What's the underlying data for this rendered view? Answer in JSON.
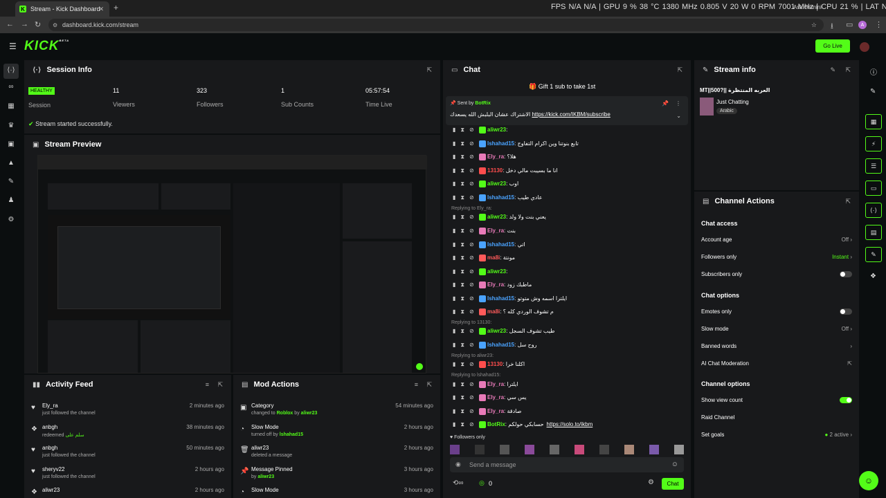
{
  "browser": {
    "tab_title": "Stream - Kick Dashboard",
    "url": "dashboard.kick.com/stream",
    "ask_gemini": "Ask Gemini",
    "perf": "FPS N/A N/A | GPU 9 % 38 °C 1380 MHz 0.805 V 20 W 0 RPM 7001 MHz | CPU 21 % | LAT N/A N/A"
  },
  "topbar": {
    "logo": "KICK",
    "beta": "BETA",
    "go_live": "Go Live"
  },
  "session": {
    "title": "Session Info",
    "status_badge": "HEALTHY",
    "session_label": "Session",
    "stats": [
      {
        "value": "11",
        "label": "Viewers"
      },
      {
        "value": "323",
        "label": "Followers"
      },
      {
        "value": "1",
        "label": "Sub Counts"
      },
      {
        "value": "05:57:54",
        "label": "Time Live"
      }
    ],
    "notice": "Stream started successfully."
  },
  "preview": {
    "title": "Stream Preview"
  },
  "activity": {
    "title": "Activity Feed",
    "items": [
      {
        "name": "Ely_ra",
        "sub": "just followed the channel",
        "time": "2 minutes ago"
      },
      {
        "name": "anbgh",
        "sub": "redeemed",
        "sub2": "سلم على",
        "time": "38 minutes ago"
      },
      {
        "name": "anbgh",
        "sub": "just followed the channel",
        "time": "50 minutes ago"
      },
      {
        "name": "sheryv22",
        "sub": "just followed the channel",
        "time": "2 hours ago"
      },
      {
        "name": "aliwr23",
        "sub": "",
        "time": "2 hours ago"
      }
    ]
  },
  "mod": {
    "title": "Mod Actions",
    "items": [
      {
        "name": "Category",
        "sub": "changed to",
        "hl": "Roblox",
        "by": "by",
        "user": "aliwr23",
        "time": "54 minutes ago"
      },
      {
        "name": "Slow Mode",
        "sub": "turned off by",
        "user": "lshahad15",
        "time": "2 hours ago"
      },
      {
        "name": "aliwr23",
        "sub": "deleted a message",
        "time": "2 hours ago"
      },
      {
        "name": "Message Pinned",
        "sub": "by",
        "user": "aliwr23",
        "time": "3 hours ago"
      },
      {
        "name": "Slow Mode",
        "sub": "",
        "time": "3 hours ago"
      }
    ]
  },
  "chat": {
    "title": "Chat",
    "gift": "Gift 1 sub to take 1st",
    "pinned_sent_by": "Sent by",
    "pinned_user": "BotRix",
    "pinned_text": "الاشتراك عشان البلبش الله يسعدك",
    "pinned_link": "https://kick.com/IKBM/subscribe",
    "lines": [
      {
        "user": "aliwr23",
        "color": "#53fc18",
        "text": ""
      },
      {
        "user": "lshahad15",
        "color": "#4aa3ff",
        "text": "تابع بنوتنا وين اكرام التفاوج"
      },
      {
        "user": "Ely_ra",
        "color": "#e87ab8",
        "text": "هلا؟"
      },
      {
        "user": "13130",
        "color": "#ff4d4d",
        "text": "انا ما بسيبت مالي دخل"
      },
      {
        "user": "aliwr23",
        "color": "#53fc18",
        "text": "اوب"
      },
      {
        "user": "lshahad15",
        "color": "#4aa3ff",
        "text": "عادي طيب"
      },
      {
        "user": "aliwr23",
        "color": "#53fc18",
        "text": "يعني بنت ولا ولد"
      },
      {
        "user": "Ely_ra",
        "color": "#e87ab8",
        "text": "بنت"
      },
      {
        "user": "lshahad15",
        "color": "#4aa3ff",
        "text": "اتي"
      },
      {
        "user": "ma8i",
        "color": "#ff5a5a",
        "text": "مونتة"
      },
      {
        "user": "aliwr23",
        "color": "#53fc18",
        "text": ""
      },
      {
        "user": "Ely_ra",
        "color": "#e87ab8",
        "text": "ماطبك زود"
      },
      {
        "user": "lshahad15",
        "color": "#4aa3ff",
        "text": "ايلترا اسمه وش متوتو"
      },
      {
        "user": "ma8i",
        "color": "#ff5a5a",
        "text": "م تشوف الوردي كله ؟"
      },
      {
        "user": "aliwr23",
        "color": "#53fc18",
        "text": "طيب تشوف السجل"
      },
      {
        "user": "lshahad15",
        "color": "#4aa3ff",
        "text": "روح سل"
      },
      {
        "user": "13130",
        "color": "#ff4d4d",
        "text": "اكلنا خرا"
      },
      {
        "user": "Ely_ra",
        "color": "#e87ab8",
        "text": "ايلترا"
      },
      {
        "user": "Ely_ra",
        "color": "#e87ab8",
        "text": "يس سي"
      },
      {
        "user": "Ely_ra",
        "color": "#e87ab8",
        "text": "صادقة"
      },
      {
        "user": "BotRix",
        "color": "#53fc18",
        "text": "حسابكي حولكم",
        "link": "https://solo.to/ikbm"
      }
    ],
    "replies": [
      "Replying to Ely_ra:",
      "Replying to 13130:",
      "Replying to aliwr23:",
      "Replying to lshahad15:"
    ],
    "followers_only": "Followers only",
    "placeholder": "Send a message",
    "count": "0",
    "send": "Chat"
  },
  "stream_info": {
    "title": "Stream info",
    "stream_title": "MT||500?|| العربه المنتظرة",
    "category": "Just Chatting",
    "tag": "Arabic"
  },
  "channel_actions": {
    "title": "Channel Actions",
    "chat_access": "Chat access",
    "account_age": "Account age",
    "account_age_val": "Off",
    "followers_only": "Followers only",
    "followers_only_val": "Instant",
    "subscribers_only": "Subscribers only",
    "chat_options": "Chat options",
    "emotes_only": "Emotes only",
    "slow_mode": "Slow mode",
    "slow_mode_val": "Off",
    "banned_words": "Banned words",
    "ai_mod": "AI Chat Moderation",
    "channel_options": "Channel options",
    "show_view_count": "Show view count",
    "raid_channel": "Raid Channel",
    "set_goals": "Set goals",
    "set_goals_val": "2 active"
  }
}
